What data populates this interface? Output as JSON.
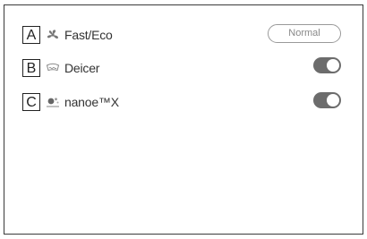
{
  "settings": {
    "items": [
      {
        "key": "A",
        "icon": "fan-icon",
        "label": "Fast/Eco",
        "control": "button",
        "button_label": "Normal"
      },
      {
        "key": "B",
        "icon": "deicer-icon",
        "label": "Deicer",
        "control": "toggle",
        "state": "on"
      },
      {
        "key": "C",
        "icon": "nanoe-icon",
        "label": "nanoe™X",
        "control": "toggle",
        "state": "on"
      }
    ]
  },
  "colors": {
    "toggle_on": "#6c6c6c",
    "border": "#3a3a3a",
    "text": "#333333"
  }
}
